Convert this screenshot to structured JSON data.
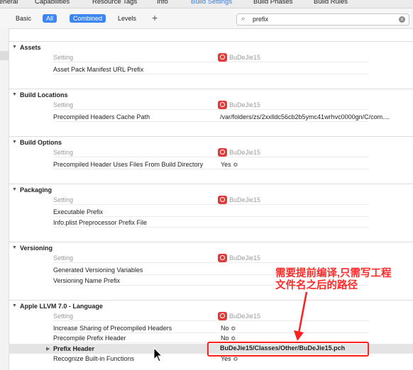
{
  "tabs": [
    "eneral",
    "Capabilities",
    "Resource Tags",
    "Info",
    "Build Settings",
    "Build Phases",
    "Build Rules"
  ],
  "active_tab": "Build Settings",
  "filter": {
    "basic": "Basic",
    "all": "All",
    "combined": "Combined",
    "levels": "Levels",
    "add": "+",
    "search_value": "prefix"
  },
  "target_name": "BuDeJie15",
  "setting_header": "Setting",
  "sections": {
    "assets": {
      "title": "Assets",
      "rows": [
        {
          "name": "Asset Pack Manifest URL Prefix",
          "value": ""
        }
      ]
    },
    "build_locations": {
      "title": "Build Locations",
      "rows": [
        {
          "name": "Precompiled Headers Cache Path",
          "value": "/var/folders/zs/2xxlldc56cb2b5ymc41wrhvc0000gn/C/com...."
        }
      ]
    },
    "build_options": {
      "title": "Build Options",
      "rows": [
        {
          "name": "Precompiled Header Uses Files From Build Directory",
          "value": "Yes ≎"
        }
      ]
    },
    "packaging": {
      "title": "Packaging",
      "rows": [
        {
          "name": "Executable Prefix",
          "value": ""
        },
        {
          "name": "Info.plist Preprocessor Prefix File",
          "value": ""
        }
      ]
    },
    "versioning": {
      "title": "Versioning",
      "rows": [
        {
          "name": "Generated Versioning Variables",
          "value": ""
        },
        {
          "name": "Versioning Name Prefix",
          "value": ""
        }
      ]
    },
    "llvm": {
      "title": "Apple LLVM 7.0 - Language",
      "rows": [
        {
          "name": "Increase Sharing of Precompiled Headers",
          "value": "No ≎"
        },
        {
          "name": "Precompile Prefix Header",
          "value": "No ≎"
        },
        {
          "name": "Prefix Header",
          "value": "BuDeJie15/Classes/Other/BuDeJie15.pch"
        },
        {
          "name": "Recognize Built-in Functions",
          "value": "Yes ≎"
        }
      ]
    }
  },
  "annotation": {
    "line1": "需要提前编译,只需写工程",
    "line2": "文件名之后的路径"
  },
  "colors": {
    "accent": "#3d85f0",
    "annotation": "#ff2020",
    "app_icon": "#e23a3a"
  }
}
